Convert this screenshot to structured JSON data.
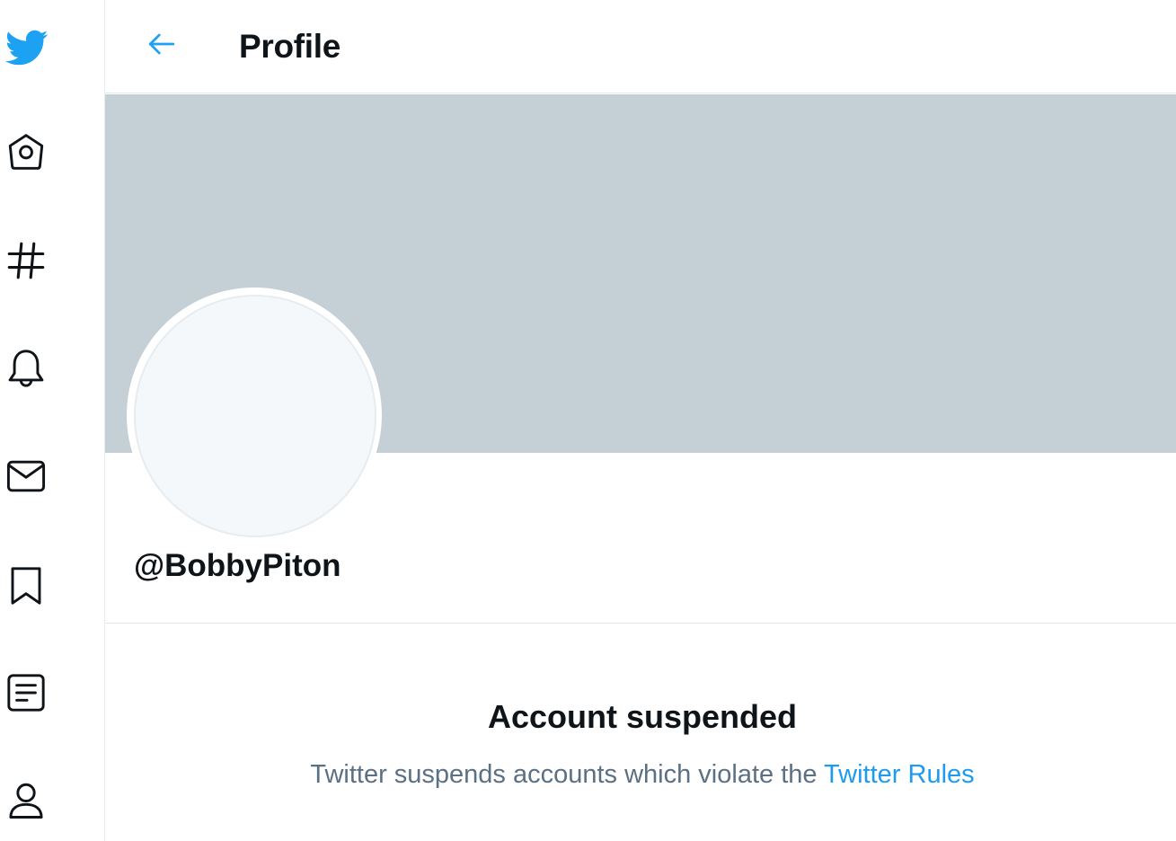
{
  "colors": {
    "brand": "#1da1f2",
    "link": "#1d9bf0",
    "banner": "#c4cfd6",
    "muted_text": "#5b7083",
    "icon": "#0f1419"
  },
  "nav": {
    "items": [
      {
        "icon": "twitter-bird-icon"
      },
      {
        "icon": "home-icon"
      },
      {
        "icon": "hashtag-icon"
      },
      {
        "icon": "bell-icon"
      },
      {
        "icon": "mail-icon"
      },
      {
        "icon": "bookmark-icon"
      },
      {
        "icon": "list-icon"
      },
      {
        "icon": "profile-icon"
      }
    ]
  },
  "header": {
    "back_icon": "arrow-left-icon",
    "title": "Profile"
  },
  "profile": {
    "handle": "@BobbyPiton"
  },
  "suspension": {
    "title": "Account suspended",
    "message_prefix": "Twitter suspends accounts which violate the ",
    "link_text": "Twitter Rules"
  }
}
